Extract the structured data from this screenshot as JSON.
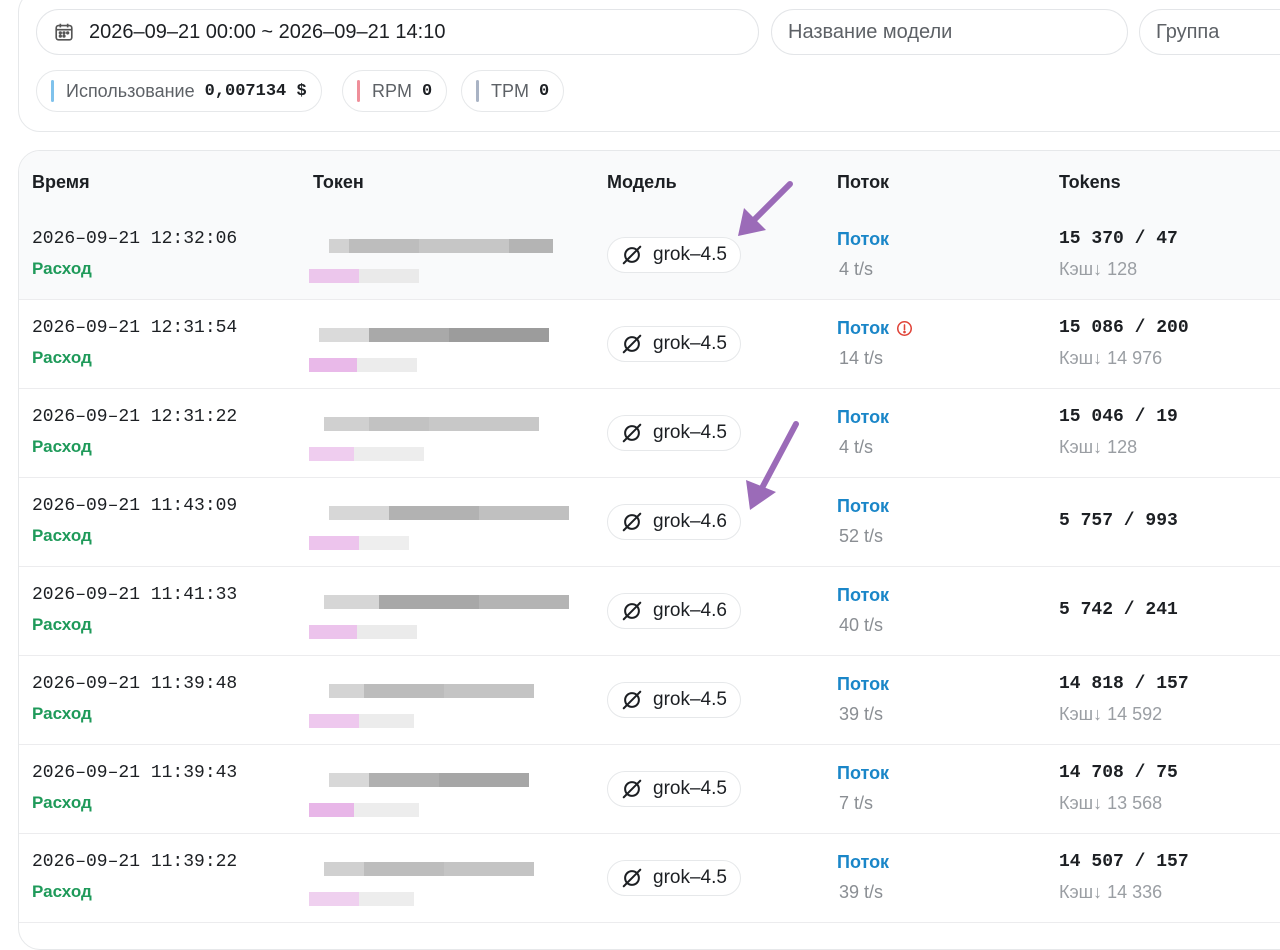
{
  "filters": {
    "date_range": "2026–09–21 00:00 ~ 2026–09–21 14:10",
    "model_placeholder": "Название модели",
    "group_placeholder": "Группа"
  },
  "stats": {
    "usage_label": "Использование",
    "usage_value": "0,007134 $",
    "rpm_label": "RPM",
    "rpm_value": "0",
    "tpm_label": "TPM",
    "tpm_value": "0",
    "colors": {
      "usage": "#7fc2ec",
      "rpm": "#ef8f9a",
      "tpm": "#a9b3c4"
    }
  },
  "table": {
    "headers": {
      "time": "Время",
      "token": "Токен",
      "model": "Модель",
      "stream": "Поток",
      "tokens": "Tokens"
    },
    "rows": [
      {
        "time": "2026–09–21 12:32:06",
        "type": "Расход",
        "model": "grok–4.5",
        "stream": "Поток",
        "warning": false,
        "speed": "4 t/s",
        "tokens": "15 370 / 47",
        "cache": "Кэш↓ 128"
      },
      {
        "time": "2026–09–21 12:31:54",
        "type": "Расход",
        "model": "grok–4.5",
        "stream": "Поток",
        "warning": true,
        "speed": "14 t/s",
        "tokens": "15 086 / 200",
        "cache": "Кэш↓ 14 976"
      },
      {
        "time": "2026–09–21 12:31:22",
        "type": "Расход",
        "model": "grok–4.5",
        "stream": "Поток",
        "warning": false,
        "speed": "4 t/s",
        "tokens": "15 046 / 19",
        "cache": "Кэш↓ 128"
      },
      {
        "time": "2026–09–21 11:43:09",
        "type": "Расход",
        "model": "grok–4.6",
        "stream": "Поток",
        "warning": false,
        "speed": "52 t/s",
        "tokens": "5 757 / 993",
        "cache": ""
      },
      {
        "time": "2026–09–21 11:41:33",
        "type": "Расход",
        "model": "grok–4.6",
        "stream": "Поток",
        "warning": false,
        "speed": "40 t/s",
        "tokens": "5 742 / 241",
        "cache": ""
      },
      {
        "time": "2026–09–21 11:39:48",
        "type": "Расход",
        "model": "grok–4.5",
        "stream": "Поток",
        "warning": false,
        "speed": "39 t/s",
        "tokens": "14 818 / 157",
        "cache": "Кэш↓ 14 592"
      },
      {
        "time": "2026–09–21 11:39:43",
        "type": "Расход",
        "model": "grok–4.5",
        "stream": "Поток",
        "warning": false,
        "speed": "7 t/s",
        "tokens": "14 708 / 75",
        "cache": "Кэш↓ 13 568"
      },
      {
        "time": "2026–09–21 11:39:22",
        "type": "Расход",
        "model": "grok–4.5",
        "stream": "Поток",
        "warning": false,
        "speed": "39 t/s",
        "tokens": "14 507 / 157",
        "cache": "Кэш↓ 14 336"
      }
    ]
  },
  "colors": {
    "stream": "#1a86c8",
    "type": "#1f9a5a",
    "warning": "#e0453a",
    "annotation_arrow": "#9b6bb8"
  },
  "icons": {
    "calendar": "calendar-icon",
    "model": "grok-logo-icon",
    "warning": "alert-circle-icon"
  }
}
